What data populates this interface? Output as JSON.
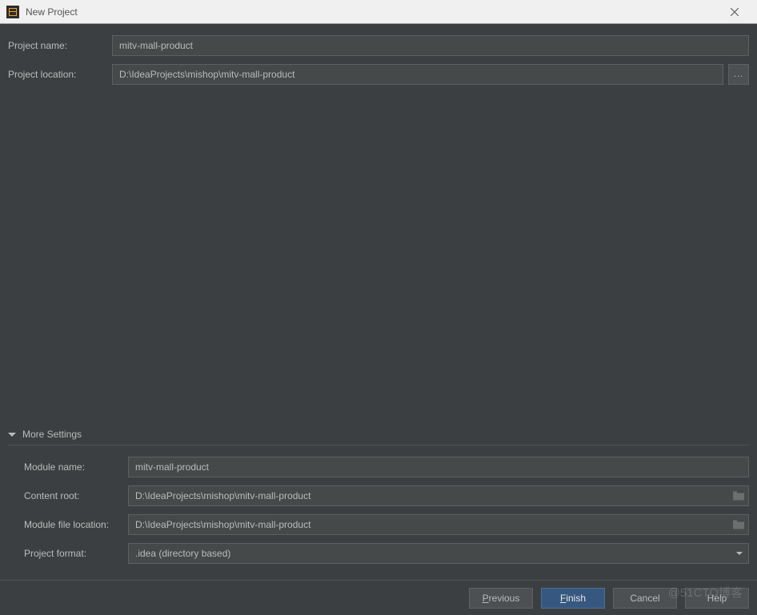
{
  "titlebar": {
    "title": "New Project"
  },
  "form": {
    "project_name_label": "Project name:",
    "project_name_value": "mitv-mall-product",
    "project_location_label": "Project location:",
    "project_location_value": "D:\\IdeaProjects\\mishop\\mitv-mall-product",
    "browse_label": "..."
  },
  "more_settings": {
    "header": "More Settings",
    "module_name_label": "Module name:",
    "module_name_value": "mitv-mall-product",
    "content_root_label": "Content root:",
    "content_root_value": "D:\\IdeaProjects\\mishop\\mitv-mall-product",
    "module_file_location_label": "Module file location:",
    "module_file_location_value": "D:\\IdeaProjects\\mishop\\mitv-mall-product",
    "project_format_label": "Project format:",
    "project_format_value": ".idea (directory based)"
  },
  "buttons": {
    "previous_mnemonic": "P",
    "previous_rest": "revious",
    "finish_mnemonic": "F",
    "finish_rest": "inish",
    "cancel": "Cancel",
    "help": "Help"
  },
  "watermark": "@51CTO博客"
}
